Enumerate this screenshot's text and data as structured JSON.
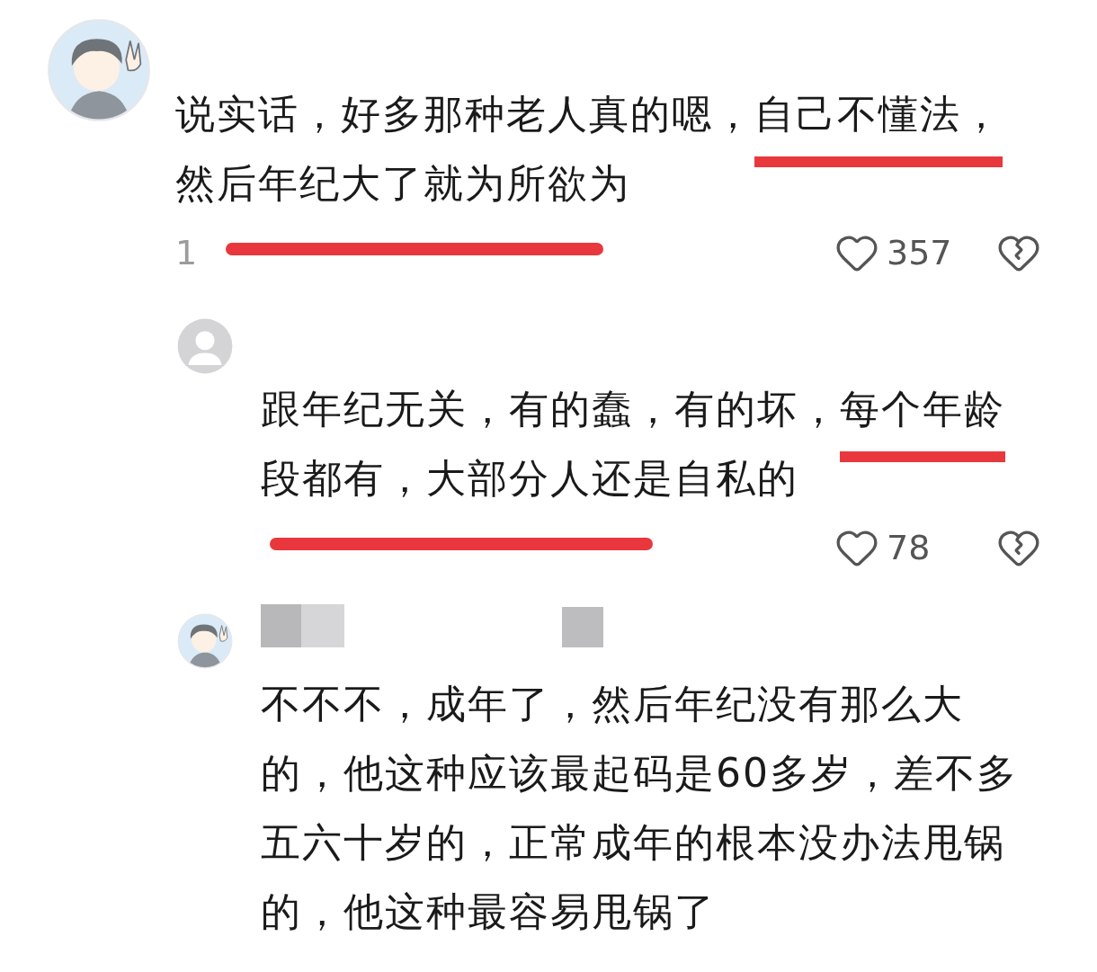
{
  "comments": [
    {
      "avatar": {
        "kind": "cartoon"
      },
      "lines": [
        [
          {
            "text": "说实话，好多那种老人真的嗯，",
            "marked": false
          },
          {
            "text": "自己不懂法，",
            "marked": true
          }
        ],
        [
          {
            "text": "然后年纪大了就为所欲为",
            "marked": false
          }
        ]
      ],
      "meta": {
        "time": "1",
        "struck": true
      },
      "likes": "357",
      "replies": [
        {
          "avatar": {
            "kind": "default"
          },
          "lines": [
            [
              {
                "text": "跟年纪无关，有的蠢，有的坏，",
                "marked": false
              },
              {
                "text": "每个年龄",
                "marked": true
              }
            ],
            [
              {
                "text": "段都有，大部分人还是自私的",
                "marked": false
              }
            ]
          ],
          "meta": {
            "struck": true
          },
          "likes": "78"
        },
        {
          "avatar": {
            "kind": "cartoon"
          },
          "lines": [
            [
              {
                "text": "不不不，成年了，然后年纪没有那么大",
                "marked": false
              }
            ],
            [
              {
                "text": "的，他这种应该最起码是60多岁，差不多",
                "marked": false
              }
            ],
            [
              {
                "text": "五六十岁的，正常成年的根本没办法甩锅",
                "marked": false
              }
            ],
            [
              {
                "text": "的，他这种最容易甩锅了",
                "marked": false
              }
            ]
          ]
        }
      ]
    }
  ]
}
